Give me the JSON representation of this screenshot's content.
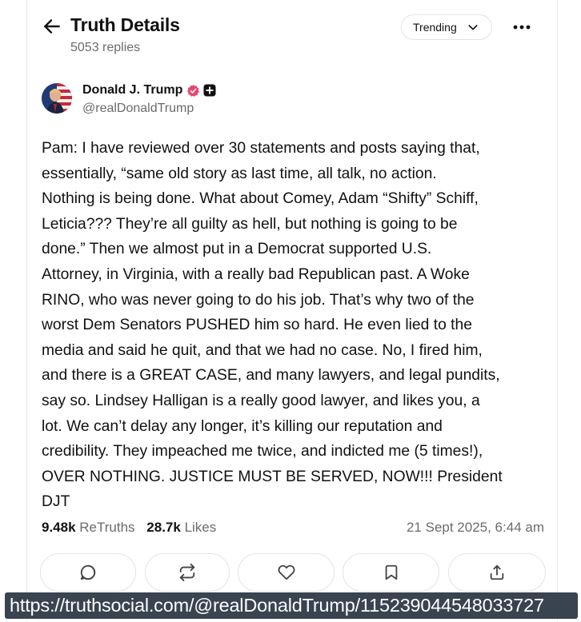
{
  "header": {
    "title": "Truth Details",
    "replies": "5053 replies",
    "sort_label": "Trending",
    "back_icon": "arrow-left-icon",
    "more_icon": "more-horizontal-icon"
  },
  "post": {
    "author_name": "Donald J. Trump",
    "author_handle": "@realDonaldTrump",
    "verified_color": "#e8466a",
    "text": "Pam: I have reviewed over 30 statements and posts saying that,\nessentially, “same old story as last time, all talk, no action.\nNothing is being done. What about Comey, Adam “Shifty” Schiff,\nLeticia??? They’re all guilty as hell, but nothing is going to be\ndone.” Then we almost put in a Democrat supported U.S.\nAttorney, in Virginia, with a really bad Republican past. A Woke\nRINO, who was never going to do his job. That’s why two of the\nworst Dem Senators PUSHED him so hard. He even lied to the\nmedia and said he quit, and that we had no case. No, I fired him,\nand there is a GREAT CASE, and many lawyers, and legal pundits,\nsay so. Lindsey Halligan is a really good lawyer, and likes you, a\nlot. We can’t delay any longer, it’s killing our reputation and\ncredibility. They impeached me twice, and indicted me (5 times!),\nOVER NOTHING. JUSTICE MUST BE SERVED, NOW!!! President\nDJT",
    "retruths_count": "9.48k",
    "retruths_label": "ReTruths",
    "likes_count": "28.7k",
    "likes_label": "Likes",
    "timestamp": "21 Sept 2025, 6:44 am"
  },
  "actions": [
    "reply-icon",
    "retruth-icon",
    "like-icon",
    "bookmark-icon",
    "share-icon"
  ],
  "url_overlay": "https://truthsocial.com/@realDonaldTrump/115239044548033727"
}
